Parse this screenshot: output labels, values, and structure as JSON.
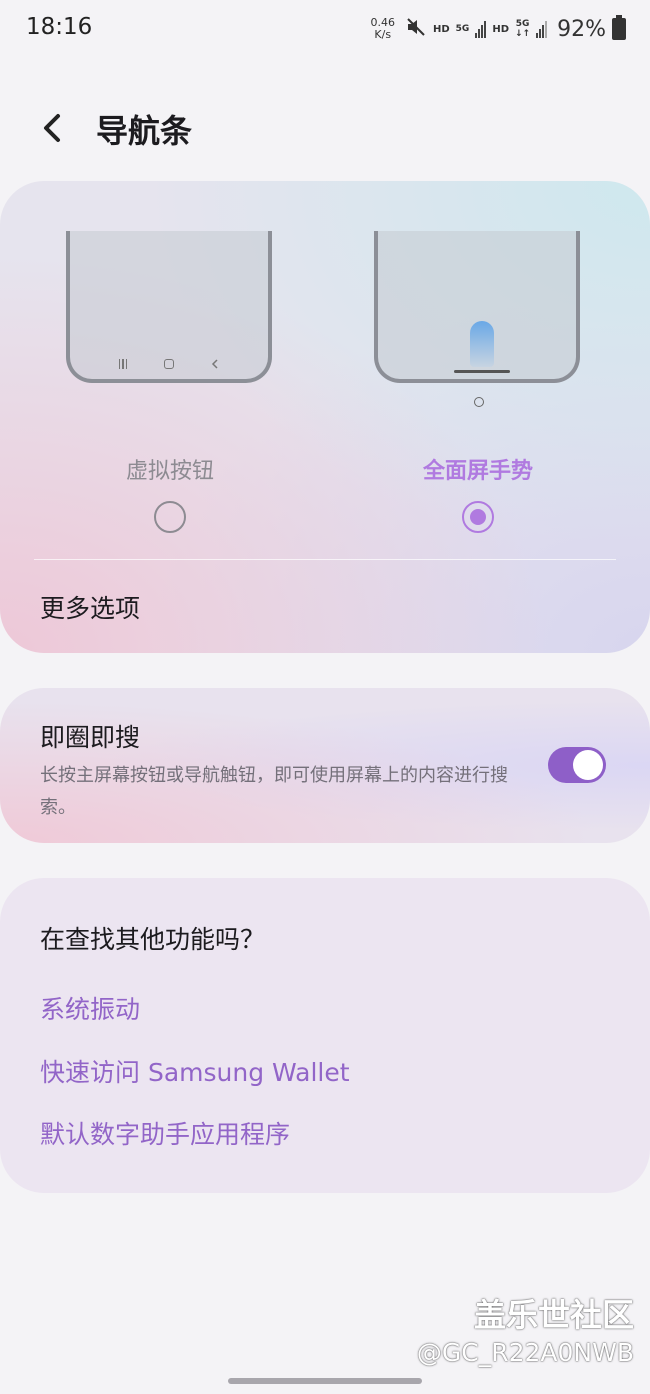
{
  "status_bar": {
    "time": "18:16",
    "net_speed_value": "0.46",
    "net_speed_unit": "K/s",
    "hd_1": "HD",
    "fiveg_1": "5G",
    "hd_2": "HD",
    "fiveg_2": "5G",
    "battery_percent": "92%"
  },
  "header": {
    "title": "导航条"
  },
  "navigation": {
    "options": [
      {
        "label": "虚拟按钮",
        "selected": false
      },
      {
        "label": "全面屏手势",
        "selected": true
      }
    ],
    "more_options_label": "更多选项"
  },
  "circle_to_search": {
    "title": "即圈即搜",
    "description": "长按主屏幕按钮或导航触钮，即可使用屏幕上的内容进行搜索。",
    "enabled": true
  },
  "suggestions": {
    "heading": "在查找其他功能吗？",
    "links": [
      "系统振动",
      "快速访问 Samsung Wallet",
      "默认数字助手应用程序"
    ]
  },
  "watermark": {
    "line1": "盖乐世社区",
    "line2": "@GC_R22A0NWB"
  },
  "colors": {
    "accent": "#b07ae0",
    "toggle_on": "#8e5fc8",
    "link": "#9265c8"
  },
  "icons": [
    "mute-icon",
    "signal-icon",
    "battery-icon",
    "back-arrow-icon"
  ]
}
